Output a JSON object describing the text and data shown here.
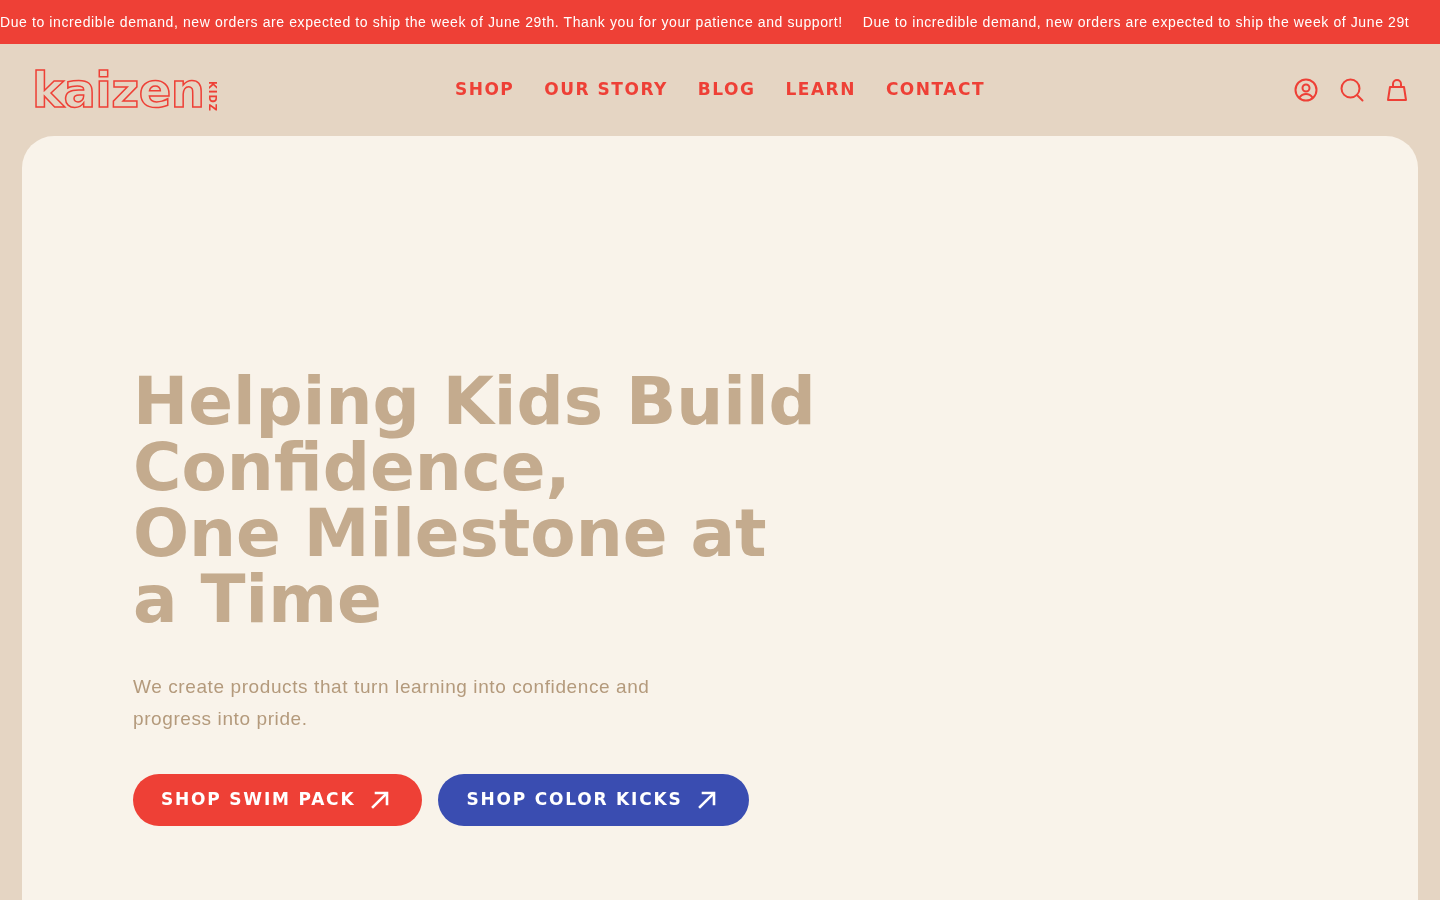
{
  "announcement_bar": {
    "messages": [
      "Due to incredible demand, new orders are expected to ship the week of June 29th. Thank you for your patience and support!",
      "Due to incredible demand, new orders are expected to ship the week of June 29t"
    ]
  },
  "header": {
    "logo": {
      "wordmark": "kaizen",
      "tagline": "KIDZ"
    },
    "nav": [
      "SHOP",
      "OUR STORY",
      "BLOG",
      "LEARN",
      "CONTACT"
    ]
  },
  "hero": {
    "heading": "Helping Kids Build Confidence,\nOne Milestone at a Time",
    "subtext": "We create products that turn learning into confidence and progress into pride.",
    "buttons": [
      {
        "label": "SHOP SWIM PACK",
        "color": "#ee4036"
      },
      {
        "label": "SHOP COLOR KICKS",
        "color": "#3a4db1"
      }
    ]
  }
}
